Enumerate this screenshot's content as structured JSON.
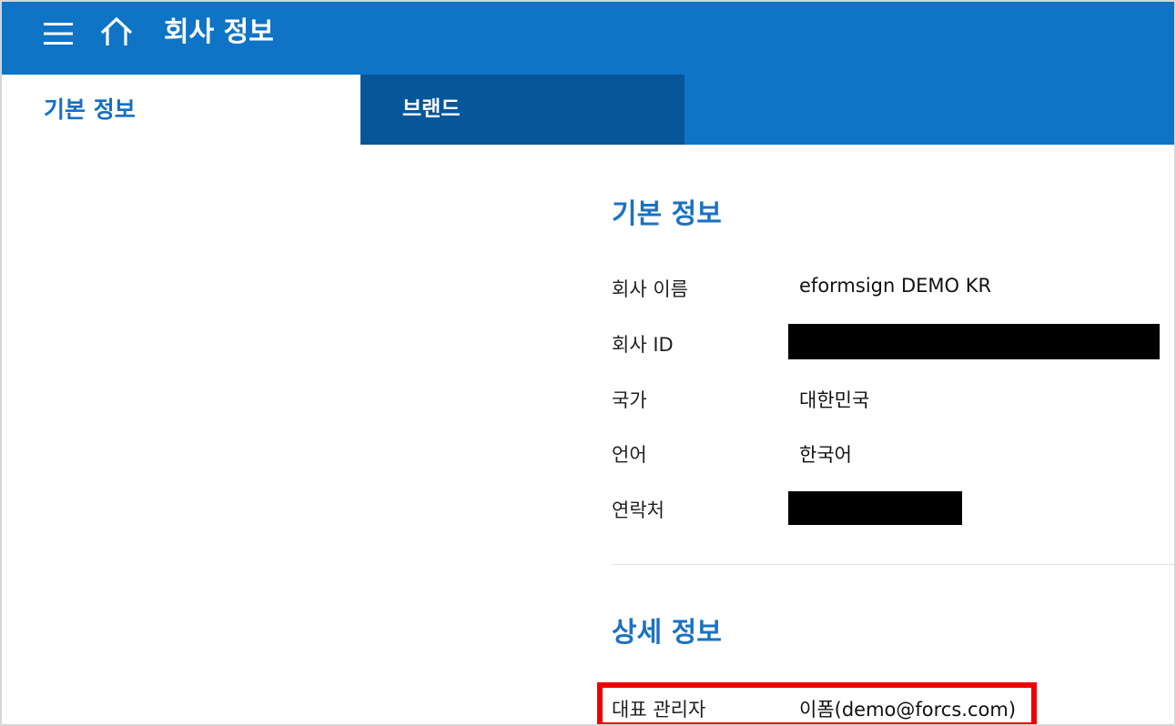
{
  "header": {
    "title": "회사 정보"
  },
  "tabs": [
    {
      "label": "기본 정보",
      "active": true
    },
    {
      "label": "브랜드",
      "active": false
    }
  ],
  "basic_info": {
    "section_title": "기본 정보",
    "rows": [
      {
        "label": "회사 이름",
        "value": "eformsign DEMO KR"
      },
      {
        "label": "회사 ID",
        "value": ""
      },
      {
        "label": "국가",
        "value": "대한민국"
      },
      {
        "label": "언어",
        "value": "한국어"
      },
      {
        "label": "연락처",
        "value": ""
      }
    ]
  },
  "detail_info": {
    "section_title": "상세 정보",
    "rows": [
      {
        "label": "대표 관리자",
        "value": "이폼(demo@forcs.com)"
      }
    ]
  },
  "colors": {
    "header_bg": "#0f74c5",
    "active_tab_text": "#1570c3",
    "inactive_tab_bg": "#06569a",
    "section_title": "#1c72c0",
    "highlight_border": "#ee0000",
    "redaction": "#000000"
  },
  "icons": {
    "menu": "hamburger-menu-icon",
    "home": "home-icon"
  }
}
